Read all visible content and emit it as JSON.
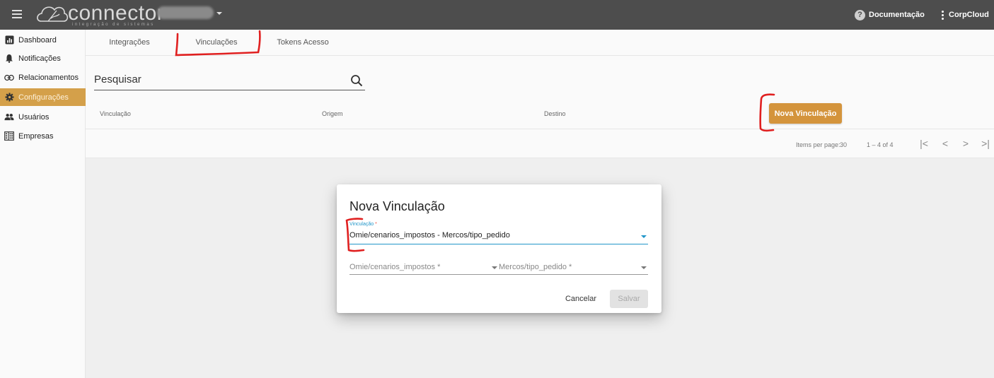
{
  "topbar": {
    "logo": "connector",
    "logo_subtitle": "integração de sistemas",
    "documentation": "Documentação",
    "user": "CorpCloud"
  },
  "sidebar": {
    "items": [
      {
        "label": "Dashboard",
        "icon": "dashboard-icon",
        "active": false
      },
      {
        "label": "Notificações",
        "icon": "bell-icon",
        "active": false
      },
      {
        "label": "Relacionamentos",
        "icon": "link-icon",
        "active": false
      },
      {
        "label": "Configurações",
        "icon": "gear-icon",
        "active": true
      },
      {
        "label": "Usuários",
        "icon": "users-icon",
        "active": false
      },
      {
        "label": "Empresas",
        "icon": "building-icon",
        "active": false
      }
    ]
  },
  "tabs": [
    {
      "label": "Integrações"
    },
    {
      "label": "Vinculações"
    },
    {
      "label": "Tokens Acesso"
    }
  ],
  "search": {
    "placeholder": "Pesquisar"
  },
  "table": {
    "columns": [
      "Vinculação",
      "Origem",
      "Destino"
    ],
    "new_button": "Nova Vinculação"
  },
  "paginator": {
    "items_per_page_label": "Items per page:",
    "items_per_page": "30",
    "range": "1 – 4 of 4"
  },
  "dialog": {
    "title": "Nova Vinculação",
    "vinculacao_label": "Vinculação",
    "required_mark": "*",
    "vinculacao_value": "Omie/cenarios_impostos - Mercos/tipo_pedido",
    "origem_placeholder": "Omie/cenarios_impostos *",
    "destino_placeholder": "Mercos/tipo_pedido *",
    "cancel": "Cancelar",
    "save": "Salvar"
  },
  "colors": {
    "topbar": "#4d4d4d",
    "accent": "#d4943c",
    "focus": "#2196c9",
    "annotation": "#e02020"
  }
}
